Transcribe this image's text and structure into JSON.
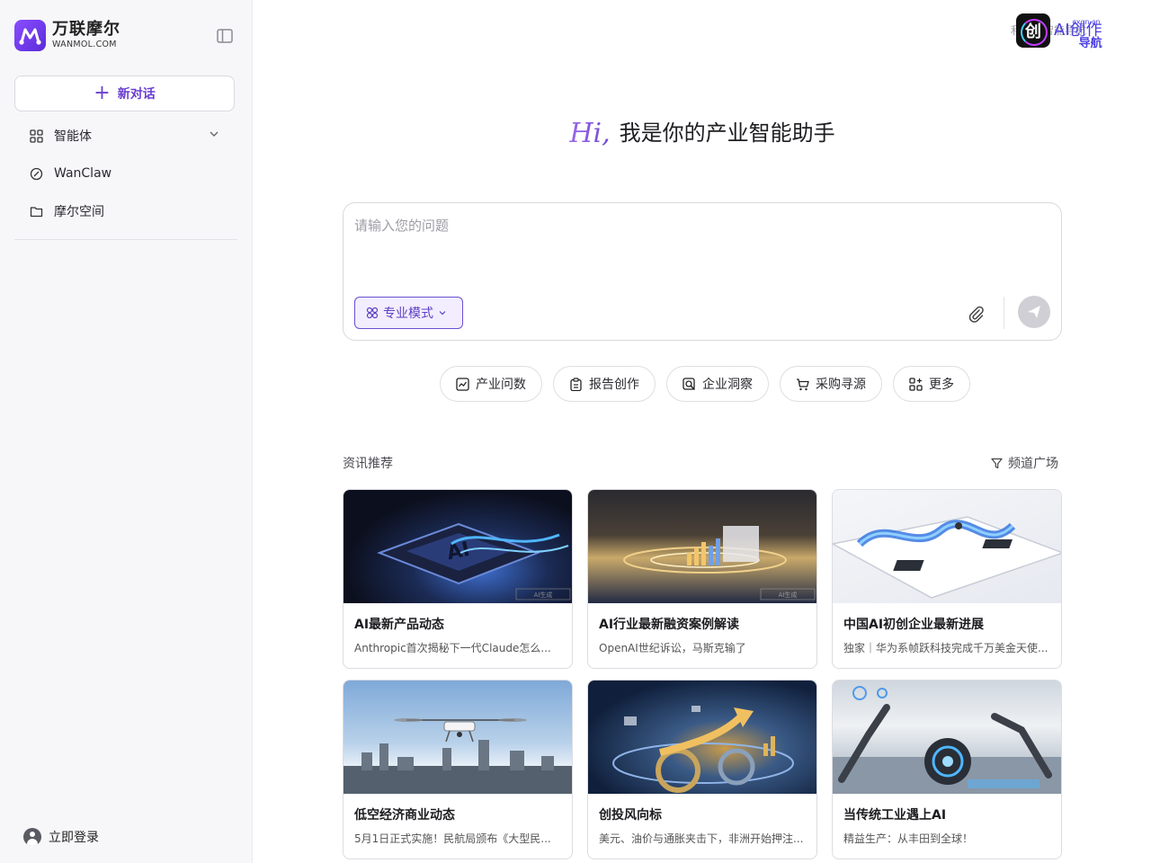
{
  "brand": {
    "name_cn": "万联摩尔",
    "name_en": "WANMOL.COM"
  },
  "sidebar": {
    "new_chat": "新对话",
    "items": [
      {
        "label": "智能体",
        "icon": "grid-icon",
        "has_dropdown": true
      },
      {
        "label": "WanClaw",
        "icon": "edit-icon"
      },
      {
        "label": "摩尔空间",
        "icon": "folder-icon"
      }
    ],
    "login": "立即登录"
  },
  "topright": {
    "ghost_text": "和产业智能导航",
    "badge_char": "创",
    "title": "AI创作",
    "subtitle": "导航",
    "domain": "cxgn.cn"
  },
  "hero": {
    "greeting": "Hi,",
    "tagline": "我是你的产业智能助手"
  },
  "composer": {
    "placeholder": "请输入您的问题",
    "mode_label": "专业模式"
  },
  "chips": [
    {
      "label": "产业问数",
      "icon": "chart-icon"
    },
    {
      "label": "报告创作",
      "icon": "clipboard-icon"
    },
    {
      "label": "企业洞察",
      "icon": "search-doc-icon"
    },
    {
      "label": "采购寻源",
      "icon": "cart-icon"
    },
    {
      "label": "更多",
      "icon": "apps-icon"
    }
  ],
  "news": {
    "section_title": "资讯推荐",
    "channel_link": "频道广场",
    "cards": [
      {
        "title": "AI最新产品动态",
        "subtitle": "Anthropic首次揭秘下一代Claude怎么..."
      },
      {
        "title": "AI行业最新融资案例解读",
        "subtitle": "OpenAI世纪诉讼，马斯克输了"
      },
      {
        "title": "中国AI初创企业最新进展",
        "subtitle": "独家｜华为系帧跃科技完成千万美金天使..."
      },
      {
        "title": "低空经济商业动态",
        "subtitle": "5月1日正式实施！民航局颁布《大型民..."
      },
      {
        "title": "创投风向标",
        "subtitle": "美元、油价与通胀夹击下，非洲开始押注..."
      },
      {
        "title": "当传统工业遇上AI",
        "subtitle": "精益生产：从丰田到全球！"
      }
    ],
    "image_labels": [
      "AI",
      "AI生成",
      "AI生成"
    ]
  },
  "colors": {
    "accent": "#6a3fd0",
    "accent_light": "#f2eeff",
    "send_disabled": "#cfcfd5"
  }
}
